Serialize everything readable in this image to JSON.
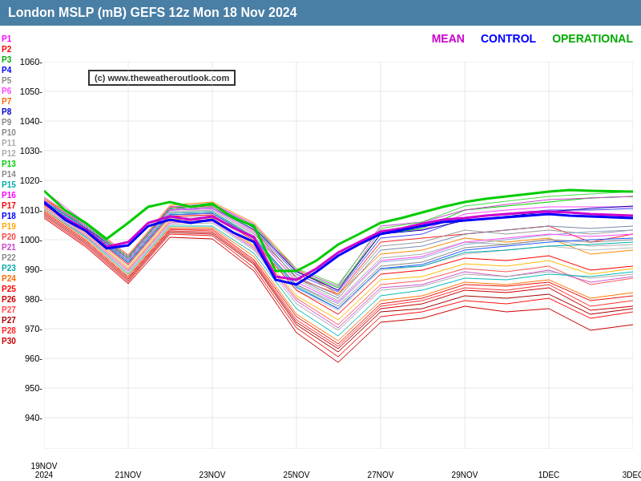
{
  "header": {
    "title": "London MSLP (mB) GEFS 12z Mon 18 Nov 2024"
  },
  "legend_top": {
    "mean_label": "MEAN",
    "mean_color": "#cc00cc",
    "control_label": "CONTROL",
    "control_color": "#0000ff",
    "operational_label": "OPERATIONAL",
    "operational_color": "#00aa00"
  },
  "watermark": {
    "text": "(c) www.theweatheroutlook.com"
  },
  "y_axis": {
    "labels": [
      "1060",
      "1050",
      "1040",
      "1030",
      "1020",
      "1010",
      "1000",
      "990",
      "980",
      "970",
      "960",
      "950",
      "940"
    ],
    "values": [
      1060,
      1050,
      1040,
      1030,
      1020,
      1010,
      1000,
      990,
      980,
      970,
      960,
      950,
      940
    ]
  },
  "x_axis": {
    "labels": [
      "19NOV\n2024",
      "21NOV",
      "23NOV",
      "25NOV",
      "27NOV",
      "29NOV",
      "1DEC",
      "3DEC"
    ]
  },
  "legend_left": [
    {
      "label": "P1",
      "color": "#ff00ff"
    },
    {
      "label": "P2",
      "color": "#ff0000"
    },
    {
      "label": "P3",
      "color": "#00aa00"
    },
    {
      "label": "P4",
      "color": "#0000ff"
    },
    {
      "label": "P5",
      "color": "#888888"
    },
    {
      "label": "P6",
      "color": "#ff44ff"
    },
    {
      "label": "P7",
      "color": "#ff6600"
    },
    {
      "label": "P8",
      "color": "#0000cc"
    },
    {
      "label": "P9",
      "color": "#888888"
    },
    {
      "label": "P10",
      "color": "#888888"
    },
    {
      "label": "P11",
      "color": "#aaaaaa"
    },
    {
      "label": "P12",
      "color": "#aaaaaa"
    },
    {
      "label": "P13",
      "color": "#00cc00"
    },
    {
      "label": "P14",
      "color": "#888888"
    },
    {
      "label": "P15",
      "color": "#00aaaa"
    },
    {
      "label": "P16",
      "color": "#ff00ff"
    },
    {
      "label": "P17",
      "color": "#ff0000"
    },
    {
      "label": "P18",
      "color": "#0000ff"
    },
    {
      "label": "P19",
      "color": "#ffaa00"
    },
    {
      "label": "P20",
      "color": "#ff4444"
    },
    {
      "label": "P21",
      "color": "#cc44cc"
    },
    {
      "label": "P22",
      "color": "#888888"
    },
    {
      "label": "P23",
      "color": "#00aaaa"
    },
    {
      "label": "P24",
      "color": "#ff6600"
    },
    {
      "label": "P25",
      "color": "#ff0000"
    },
    {
      "label": "P26",
      "color": "#cc0000"
    },
    {
      "label": "P27",
      "color": "#ff4444"
    },
    {
      "label": "P27",
      "color": "#aa0000"
    },
    {
      "label": "P28",
      "color": "#ff2222"
    },
    {
      "label": "P30",
      "color": "#cc0000"
    }
  ]
}
